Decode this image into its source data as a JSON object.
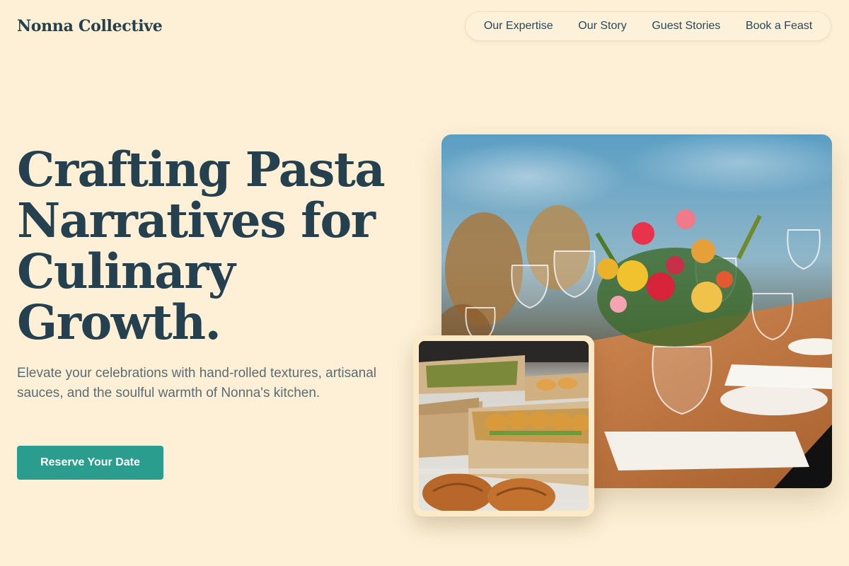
{
  "header": {
    "brand": "Nonna Collective",
    "nav": [
      "Our Expertise",
      "Our Story",
      "Guest Stories",
      "Book a Feast"
    ]
  },
  "hero": {
    "headline": "Crafting Pasta Narratives for Culinary Growth.",
    "subtext": "Elevate your celebrations with hand-rolled textures, artisanal sauces, and the soulful warmth of Nonna's kitchen.",
    "cta": "Reserve Your Date"
  },
  "images": {
    "main": "banquet-table-photo",
    "secondary": "boxed-catering-photo"
  },
  "colors": {
    "background": "#fdf0d6",
    "heading": "#25404f",
    "accent": "#2a9d8f",
    "body_text": "#5a6c74"
  }
}
